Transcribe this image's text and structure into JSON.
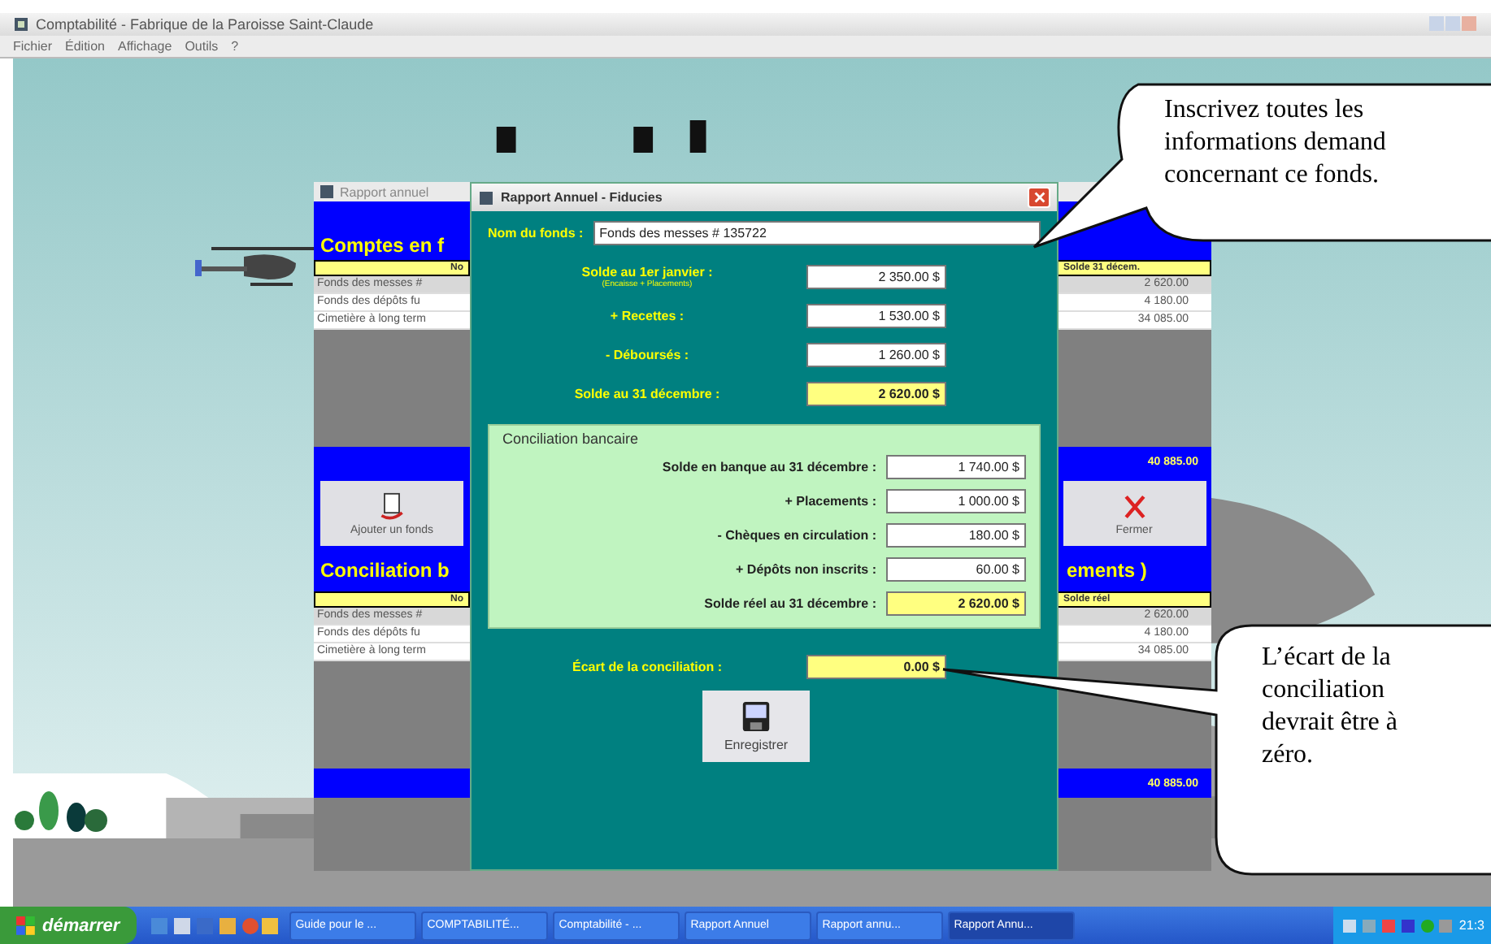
{
  "window": {
    "title": "Comptabilité - Fabrique de la Paroisse Saint-Claude"
  },
  "menu": [
    "Fichier",
    "Édition",
    "Affichage",
    "Outils",
    "?"
  ],
  "report_window": {
    "title": "Rapport annuel",
    "section_1": {
      "left_title": "Comptes en f",
      "left_header": "No",
      "right_header": "Solde 31 décem.",
      "rows": [
        {
          "name": "Fonds des messes #",
          "amount": "2 620.00"
        },
        {
          "name": "Fonds des dépôts fu",
          "amount": "4 180.00"
        },
        {
          "name": "Cimetière à long term",
          "amount": "34 085.00"
        }
      ],
      "total": "40 885.00"
    },
    "buttons": [
      {
        "kind": "add",
        "label": "Ajouter un fonds"
      },
      {
        "kind": "close",
        "label": "Fermer"
      }
    ],
    "section_2": {
      "left_title": "Conciliation b",
      "right_title": "ements )",
      "left_header": "No",
      "right_header": "Solde réel",
      "rows": [
        {
          "name": "Fonds des messes #",
          "amount": "2 620.00"
        },
        {
          "name": "Fonds des dépôts fu",
          "amount": "4 180.00"
        },
        {
          "name": "Cimetière à long term",
          "amount": "34 085.00"
        }
      ],
      "total": "40 885.00"
    }
  },
  "dialog": {
    "title": "Rapport Annuel - Fiducies",
    "fund_name": {
      "label": "Nom du fonds :",
      "value": "Fonds des messes # 135722"
    },
    "summary": [
      {
        "label": "Solde au 1er janvier :",
        "note": "(Encaisse + Placements)",
        "value": "2 350.00 $",
        "kind": "input"
      },
      {
        "label": "+ Recettes :",
        "value": "1 530.00 $",
        "kind": "input"
      },
      {
        "label": "- Déboursés :",
        "value": "1 260.00 $",
        "kind": "input"
      },
      {
        "label": "Solde au 31 décembre :",
        "value": "2 620.00 $",
        "kind": "total"
      }
    ],
    "reconciliation": {
      "title": "Conciliation bancaire",
      "rows": [
        {
          "label": "Solde en banque au 31 décembre :",
          "value": "1 740.00 $",
          "kind": "input"
        },
        {
          "label": "+ Placements :",
          "value": "1 000.00 $",
          "kind": "input"
        },
        {
          "label": "- Chèques en circulation :",
          "value": "180.00 $",
          "kind": "input"
        },
        {
          "label": "+ Dépôts non inscrits :",
          "value": "60.00 $",
          "kind": "input"
        },
        {
          "label": "Solde réel au 31 décembre :",
          "value": "2 620.00 $",
          "kind": "total"
        }
      ]
    },
    "difference": {
      "label": "Écart de la conciliation :",
      "value": "0.00 $"
    },
    "save_button": "Enregistrer"
  },
  "callouts": [
    {
      "lines": [
        "Inscrivez toutes les",
        "informations demand",
        "concernant ce fonds."
      ]
    },
    {
      "lines": [
        "L’écart de la",
        "conciliation",
        "devrait être à",
        "zéro."
      ]
    }
  ],
  "taskbar": {
    "start": "démarrer",
    "tasks": [
      {
        "label": "Guide pour le ...",
        "selected": false
      },
      {
        "label": "COMPTABILITÉ...",
        "selected": false
      },
      {
        "label": "Comptabilité - ...",
        "selected": false
      },
      {
        "label": "Rapport Annuel",
        "selected": false
      },
      {
        "label": "Rapport annu...",
        "selected": false
      },
      {
        "label": "Rapport Annu...",
        "selected": true
      }
    ],
    "clock": "21:3"
  }
}
